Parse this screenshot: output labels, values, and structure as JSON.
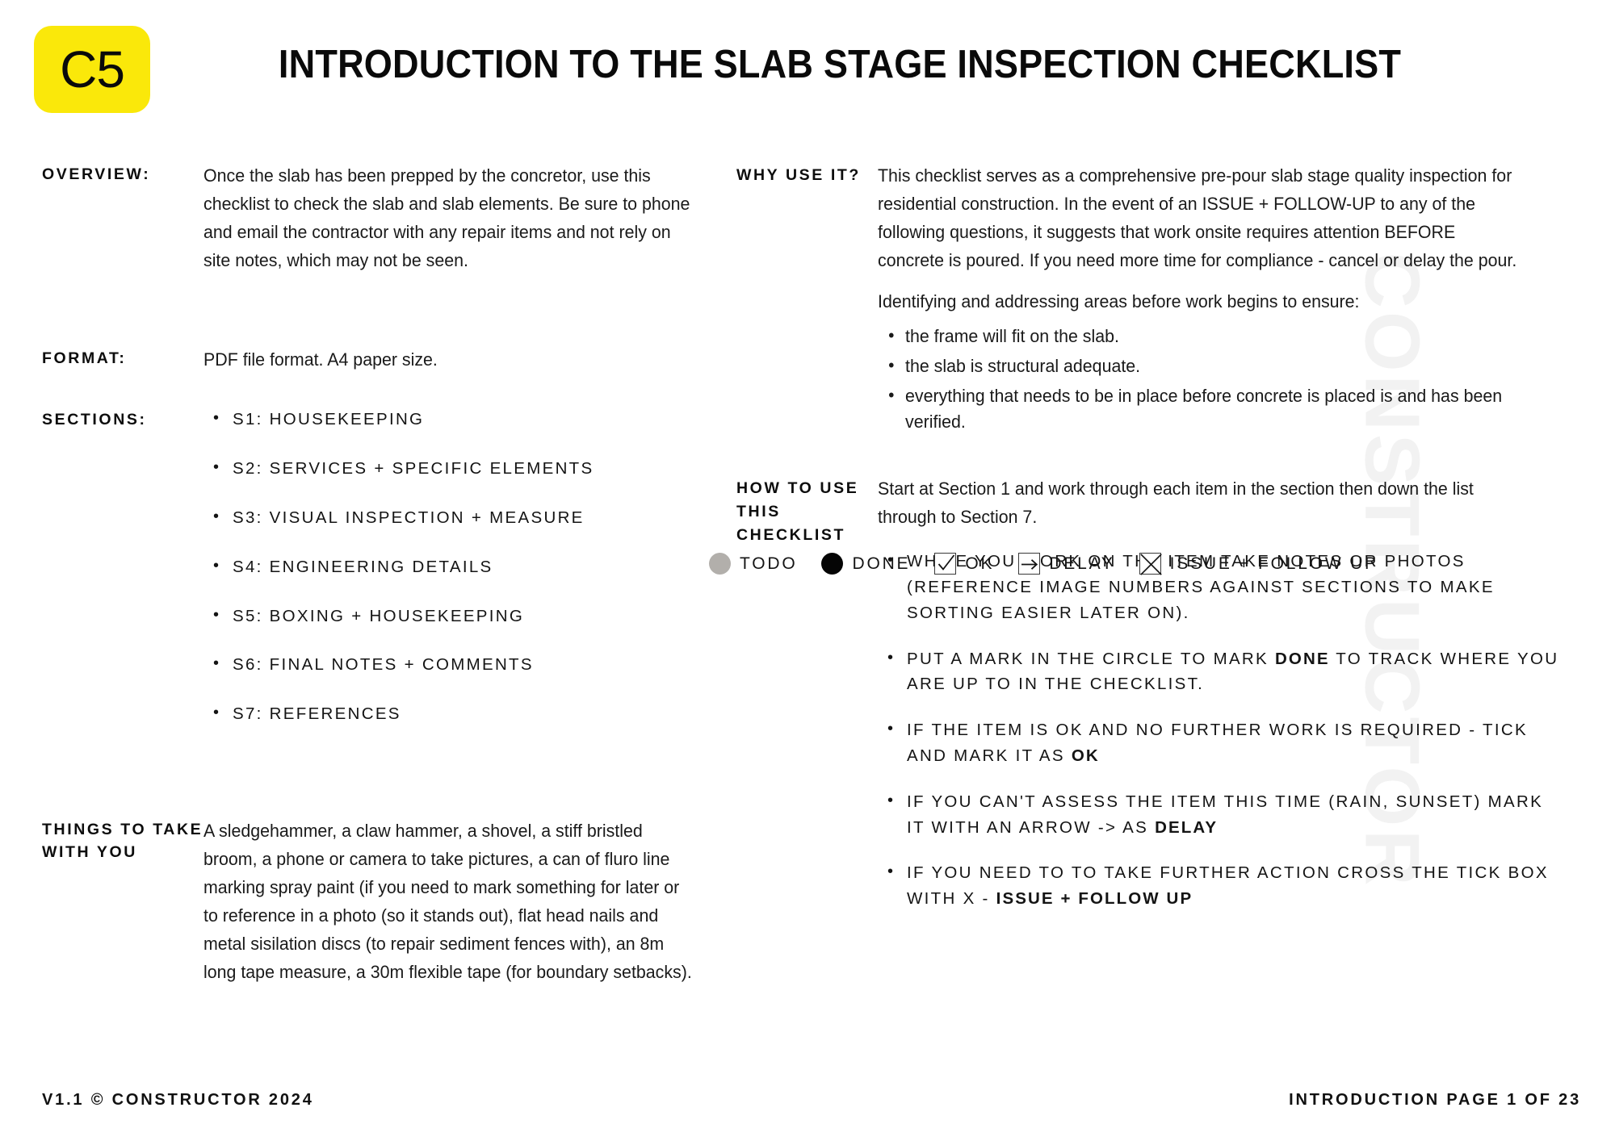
{
  "watermark": {
    "text": "CONSTRUCTOR"
  },
  "header": {
    "badge": "C5",
    "title": "INTRODUCTION TO THE SLAB STAGE INSPECTION CHECKLIST"
  },
  "left_column": {
    "overview": {
      "label": "OVERVIEW:",
      "text": "Once the slab has been prepped by the concretor, use this checklist to check the slab and slab elements. Be sure to phone and email the contractor with any repair items and not rely on site notes, which may not be seen."
    },
    "format": {
      "label": "FORMAT:",
      "text": "PDF file format. A4 paper size."
    },
    "sections": {
      "label": "SECTIONS:",
      "items": [
        "S1: HOUSEKEEPING",
        "S2: SERVICES + SPECIFIC ELEMENTS",
        "S3: VISUAL INSPECTION + MEASURE",
        "S4: ENGINEERING DETAILS",
        "S5: BOXING + HOUSEKEEPING",
        "S6: FINAL NOTES + COMMENTS",
        "S7: REFERENCES"
      ]
    },
    "things_to_take": {
      "label": "THINGS TO TAKE WITH YOU",
      "text": "A sledgehammer, a claw hammer, a shovel, a stiff bristled broom, a phone or camera to take pictures, a can of fluro line marking spray paint (if you need to mark something for later or to reference in a photo (so it stands out), flat head nails and metal sisilation discs (to repair sediment fences with), an 8m long tape measure, a 30m flexible tape (for boundary setbacks)."
    }
  },
  "right_column": {
    "why_use_it": {
      "label": "WHY USE IT?",
      "paragraph_1": "This checklist serves as a comprehensive pre-pour slab stage quality inspection for residential construction. In the event of an ISSUE + FOLLOW-UP to any of the following questions, it suggests that work onsite requires attention BEFORE concrete is poured. If you need more time for compliance - cancel or delay the pour.",
      "paragraph_2": "Identifying and addressing areas before work begins to ensure:",
      "bullets": [
        "the frame will fit on the slab.",
        "the slab is structural adequate.",
        "everything that needs to be in place before concrete is placed is and has been verified."
      ]
    },
    "how_to_use": {
      "label": "HOW TO USE THIS CHECKLIST",
      "intro": "Start at Section 1 and work through each item in the section then down the list through to Section 7.",
      "bullets": [
        {
          "text": "WHILE YOU WORK ON THE ITEM TAKE NOTES OR PHOTOS (REFERENCE IMAGE NUMBERS AGAINST SECTIONS TO MAKE SORTING EASIER LATER ON).",
          "bold_tail": "",
          "tail": ""
        },
        {
          "text": "PUT A MARK IN THE CIRCLE TO MARK ",
          "bold_tail": "DONE",
          "tail": " TO TRACK WHERE YOU ARE UP TO IN THE CHECKLIST."
        },
        {
          "text": "IF THE ITEM IS OK AND NO FURTHER WORK IS REQUIRED - TICK AND MARK IT AS ",
          "bold_tail": "OK",
          "tail": ""
        },
        {
          "text": "IF YOU CAN'T ASSESS THE ITEM THIS TIME (RAIN, SUNSET) MARK IT WITH AN ARROW -> AS ",
          "bold_tail": "DELAY",
          "tail": ""
        },
        {
          "text": "IF YOU NEED TO TO TAKE FURTHER ACTION CROSS THE TICK BOX WITH X - ",
          "bold_tail": "ISSUE + FOLLOW UP",
          "tail": ""
        }
      ]
    }
  },
  "legend": {
    "items": [
      {
        "icon": "filled-circle-grey-icon",
        "label": "TODO"
      },
      {
        "icon": "filled-circle-black-icon",
        "label": "DONE"
      },
      {
        "icon": "checkbox-tick-icon",
        "label": "OK"
      },
      {
        "icon": "box-arrow-right-icon",
        "label": "DELAY"
      },
      {
        "icon": "box-cross-icon",
        "label": "ISSUE + FOLLOW UP"
      }
    ]
  },
  "footer": {
    "left": "V1.1  © CONSTRUCTOR 2024",
    "right": "INTRODUCTION PAGE 1 OF 23"
  },
  "colors": {
    "badge_yellow": "#FAE80A",
    "todo_grey": "#B2AFAB",
    "done_black": "#050505",
    "watermark_grey": "#F2F2F2"
  }
}
